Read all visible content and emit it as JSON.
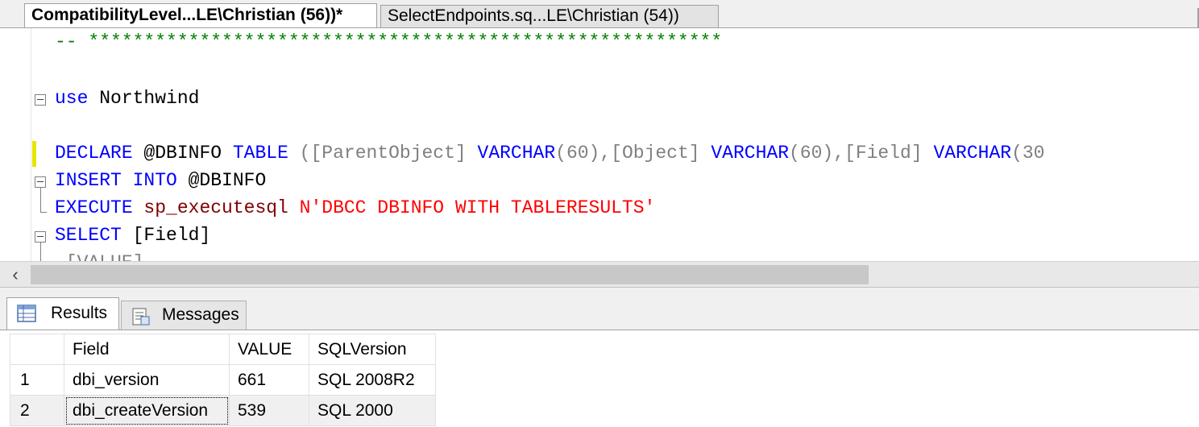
{
  "tabs": [
    {
      "label": "CompatibilityLevel...LE\\Christian (56))*",
      "active": true
    },
    {
      "label": "SelectEndpoints.sq...LE\\Christian (54))",
      "active": false
    }
  ],
  "editor": {
    "comment_line": "-- *********************************************************",
    "line_use_kw": "use",
    "line_use_db": " Northwind",
    "declare": {
      "kw1": "DECLARE",
      "var": " @DBINFO ",
      "kw2": "TABLE",
      "p1": " ([ParentObject] ",
      "kw3": "VARCHAR",
      "p2": "(60),[Object] ",
      "kw4": "VARCHAR",
      "p3": "(60),[Field] ",
      "kw5": "VARCHAR",
      "p4": "(30"
    },
    "insert": {
      "kw": "INSERT INTO",
      "var": " @DBINFO"
    },
    "execute": {
      "kw": "EXECUTE",
      "proc": " sp_executesql ",
      "str": "N'DBCC DBINFO WITH TABLERESULTS'"
    },
    "select": {
      "kw": "SELECT",
      "rest": " [Field]"
    },
    "next_partial": ",[VALUE]"
  },
  "results": {
    "tabs": [
      {
        "label": "Results",
        "icon": "grid-icon"
      },
      {
        "label": "Messages",
        "icon": "messages-icon"
      }
    ],
    "columns": [
      "",
      "Field",
      "VALUE",
      "SQLVersion"
    ],
    "rows": [
      [
        "1",
        "dbi_version",
        "661",
        "SQL 2008R2"
      ],
      [
        "2",
        "dbi_createVersion",
        "539",
        "SQL 2000"
      ]
    ]
  },
  "colors": {
    "keyword": "#0000ff",
    "string": "#ff0000",
    "comment": "#008000",
    "punctuation": "#808080"
  }
}
